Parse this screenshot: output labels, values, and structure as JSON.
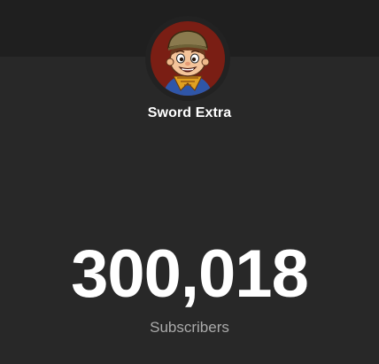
{
  "channel": {
    "name": "Sword Extra",
    "avatar_icon": "cartoon-character-avatar"
  },
  "stats": {
    "subscriber_count": "300,018",
    "subscriber_label": "Subscribers"
  },
  "colors": {
    "background": "#282828",
    "banner": "#1f1f1f",
    "text_primary": "#ffffff",
    "text_secondary": "#aaaaaa"
  }
}
